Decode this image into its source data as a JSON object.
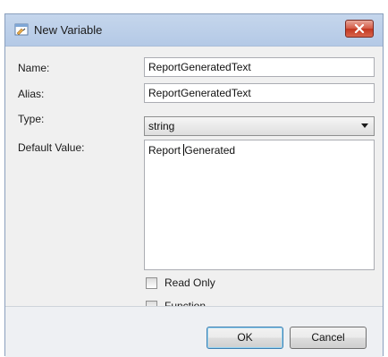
{
  "window": {
    "title": "New Variable",
    "icon": "variable-edit-icon",
    "close_icon": "close-icon",
    "close_color": "#c9452f"
  },
  "form": {
    "name_label": "Name:",
    "name_value": "ReportGeneratedText",
    "alias_label": "Alias:",
    "alias_value": "ReportGeneratedText",
    "type_label": "Type:",
    "type_value": "string",
    "default_label": "Default Value:",
    "default_before_caret": "Report ",
    "default_after_caret": "Generated",
    "read_only_label": "Read Only",
    "read_only_checked": false,
    "function_label": "Function",
    "function_checked": false
  },
  "buttons": {
    "ok_label": "OK",
    "cancel_label": "Cancel"
  }
}
